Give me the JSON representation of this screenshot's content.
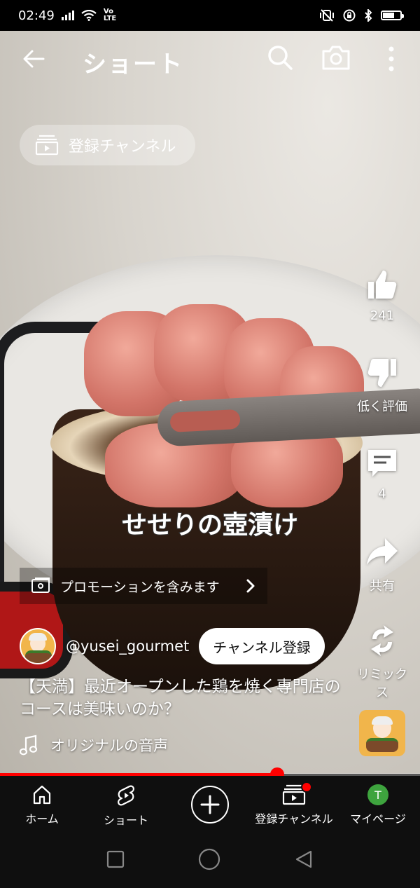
{
  "status_bar": {
    "time": "02:49",
    "network_label": "Vo LTE"
  },
  "header": {
    "title": "ショート"
  },
  "subscriptions_chip": {
    "label": "登録チャンネル"
  },
  "video": {
    "caption": "せせりの壺漬け"
  },
  "actions": {
    "like_count": "241",
    "dislike_label": "低く評価",
    "comment_count": "4",
    "share_label": "共有",
    "remix_label": "リミックス"
  },
  "promo": {
    "label": "プロモーションを含みます"
  },
  "channel": {
    "handle": "@yusei_gourmet",
    "subscribe_label": "チャンネル登録"
  },
  "video_title": "【天満】最近オープンした鶏を焼く専門店のコースは美味いのか？",
  "sound": {
    "label": "オリジナルの音声"
  },
  "playback": {
    "progress_fraction": 0.66
  },
  "bottom_nav": [
    {
      "label": "ホーム"
    },
    {
      "label": "ショート"
    },
    {
      "label": ""
    },
    {
      "label": "登録チャンネル"
    },
    {
      "label": "マイページ",
      "avatar_letter": "T"
    }
  ],
  "colors": {
    "accent_red": "#ff0000",
    "avatar_green": "#3ea43e",
    "nav_background": "#0f0f0f"
  }
}
